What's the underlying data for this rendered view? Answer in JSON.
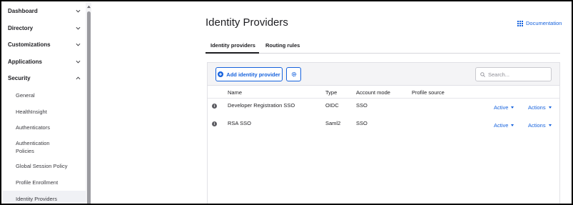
{
  "sidebar": {
    "sections": [
      {
        "label": "Dashboard",
        "expanded": false
      },
      {
        "label": "Directory",
        "expanded": false
      },
      {
        "label": "Customizations",
        "expanded": false
      },
      {
        "label": "Applications",
        "expanded": false
      },
      {
        "label": "Security",
        "expanded": true
      }
    ],
    "security_items": [
      {
        "label": "General",
        "active": false
      },
      {
        "label": "HealthInsight",
        "active": false
      },
      {
        "label": "Authenticators",
        "active": false
      },
      {
        "label": "Authentication Policies",
        "active": false
      },
      {
        "label": "Global Session Policy",
        "active": false
      },
      {
        "label": "Profile Enrollment",
        "active": false
      },
      {
        "label": "Identity Providers",
        "active": true
      }
    ]
  },
  "page": {
    "title": "Identity Providers",
    "documentation_label": "Documentation"
  },
  "tabs": [
    {
      "label": "Identity providers",
      "active": true
    },
    {
      "label": "Routing rules",
      "active": false
    }
  ],
  "toolbar": {
    "add_label": "Add identity provider",
    "search_placeholder": "Search..."
  },
  "table": {
    "columns": [
      "Name",
      "Type",
      "Account mode",
      "Profile source"
    ],
    "rows": [
      {
        "name": "Developer Registration SSO",
        "type": "OIDC",
        "account_mode": "SSO",
        "profile_source": "",
        "status": "Active",
        "actions": "Actions"
      },
      {
        "name": "RSA SSO",
        "type": "Saml2",
        "account_mode": "SSO",
        "profile_source": "",
        "status": "Active",
        "actions": "Actions"
      }
    ]
  },
  "icons": {
    "chevron": "chevron-down-icon",
    "add": "plus-circle-icon",
    "settings": "gear-icon",
    "search": "search-icon",
    "docs": "grid-icon",
    "info": "info-icon"
  },
  "colors": {
    "accent": "#1662dd",
    "text": "#1d1d21",
    "toolbar_bg": "#f4f4f6"
  }
}
